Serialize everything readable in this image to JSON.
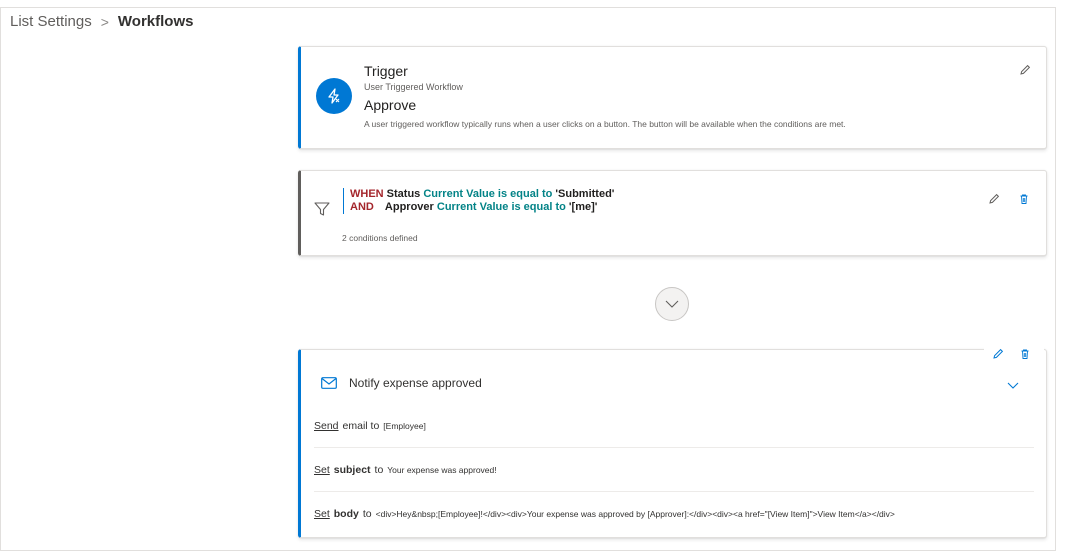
{
  "breadcrumb": {
    "parent": "List Settings",
    "separator": ">",
    "current": "Workflows"
  },
  "trigger": {
    "title": "Trigger",
    "subtitle": "User Triggered Workflow",
    "name": "Approve",
    "description": "A user triggered workflow typically runs when a user clicks on a button. The button will be available when the conditions are met.",
    "icon": "lightning-bolt-icon"
  },
  "conditions": {
    "lines": [
      {
        "keyword": "WHEN",
        "field": "Status",
        "operator": "Current Value is equal to",
        "value": "'Submitted'"
      },
      {
        "keyword": "AND",
        "field": "Approver",
        "operator": "Current Value is equal to",
        "value": "'[me]'"
      }
    ],
    "count_text": "2 conditions defined",
    "icon": "filter-icon"
  },
  "action": {
    "title": "Notify expense approved",
    "icon": "mail-icon",
    "steps": [
      {
        "verb": "Send",
        "property": "",
        "to": "email to",
        "value": "[Employee]"
      },
      {
        "verb": "Set",
        "property": "subject",
        "to": "to",
        "value": "Your expense was approved!"
      },
      {
        "verb": "Set",
        "property": "body",
        "to": "to",
        "value": "<div>Hey&nbsp;[Employee]!</div><div>Your expense was approved by [Approver]:</div><div><a href=\"[View Item]\">View Item</a></div>"
      }
    ]
  },
  "colors": {
    "accent": "#0078d4",
    "keyword": "#a4262c",
    "operator": "#038387",
    "condition_border": "#605e5c"
  }
}
